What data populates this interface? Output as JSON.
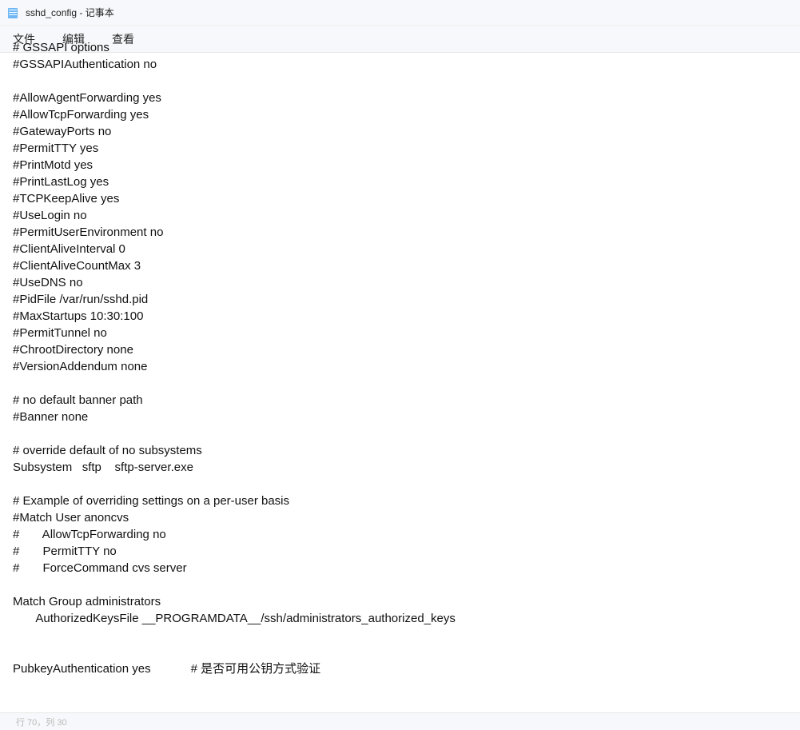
{
  "titlebar": {
    "title": "sshd_config - 记事本"
  },
  "menu": {
    "file": "文件",
    "edit": "编辑",
    "view": "查看"
  },
  "editor": {
    "lines": [
      "# GSSAPI options",
      "#GSSAPIAuthentication no",
      "",
      "#AllowAgentForwarding yes",
      "#AllowTcpForwarding yes",
      "#GatewayPorts no",
      "#PermitTTY yes",
      "#PrintMotd yes",
      "#PrintLastLog yes",
      "#TCPKeepAlive yes",
      "#UseLogin no",
      "#PermitUserEnvironment no",
      "#ClientAliveInterval 0",
      "#ClientAliveCountMax 3",
      "#UseDNS no",
      "#PidFile /var/run/sshd.pid",
      "#MaxStartups 10:30:100",
      "#PermitTunnel no",
      "#ChrootDirectory none",
      "#VersionAddendum none",
      "",
      "# no default banner path",
      "#Banner none",
      "",
      "# override default of no subsystems",
      "Subsystem   sftp    sftp-server.exe",
      "",
      "# Example of overriding settings on a per-user basis",
      "#Match User anoncvs",
      "#       AllowTcpForwarding no",
      "#       PermitTTY no",
      "#       ForceCommand cvs server",
      "",
      "Match Group administrators",
      "       AuthorizedKeysFile __PROGRAMDATA__/ssh/administrators_authorized_keys",
      "",
      "",
      "PubkeyAuthentication yes            # 是否可用公钥方式验证",
      ""
    ]
  },
  "statusbar": {
    "position": "行 70，列 30"
  }
}
